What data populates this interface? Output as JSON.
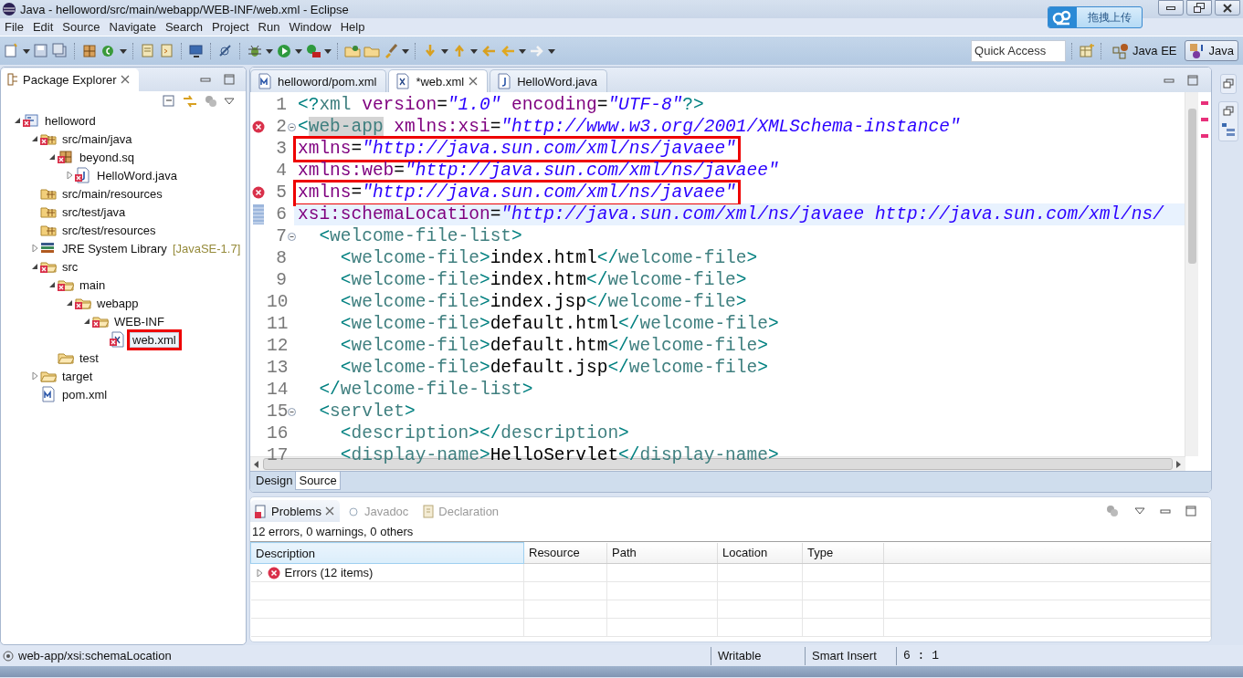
{
  "window": {
    "title": "Java - helloword/src/main/webapp/WEB-INF/web.xml - Eclipse",
    "upload_button": "拖拽上传"
  },
  "menu": [
    "File",
    "Edit",
    "Source",
    "Navigate",
    "Search",
    "Project",
    "Run",
    "Window",
    "Help"
  ],
  "quick_access": {
    "placeholder": "Quick Access"
  },
  "perspectives": [
    {
      "label": "Java EE",
      "selected": false
    },
    {
      "label": "Java",
      "selected": true
    }
  ],
  "package_explorer": {
    "title": "Package Explorer",
    "tree": [
      {
        "label": "helloword",
        "kind": "project",
        "error": true,
        "expanded": true,
        "children": [
          {
            "label": "src/main/java",
            "kind": "source-folder",
            "error": true,
            "expanded": true,
            "children": [
              {
                "label": "beyond.sq",
                "kind": "package",
                "error": true,
                "expanded": true,
                "children": [
                  {
                    "label": "HelloWord.java",
                    "kind": "java",
                    "error": true,
                    "expanded": false
                  }
                ]
              }
            ]
          },
          {
            "label": "src/main/resources",
            "kind": "source-folder",
            "error": false
          },
          {
            "label": "src/test/java",
            "kind": "source-folder",
            "error": false
          },
          {
            "label": "src/test/resources",
            "kind": "source-folder",
            "error": false
          },
          {
            "label": "JRE System Library",
            "decoration": "[JavaSE-1.7]",
            "kind": "library",
            "error": false,
            "expanded": false
          },
          {
            "label": "src",
            "kind": "folder",
            "error": true,
            "expanded": true,
            "children": [
              {
                "label": "main",
                "kind": "folder",
                "error": true,
                "expanded": true,
                "children": [
                  {
                    "label": "webapp",
                    "kind": "folder",
                    "error": true,
                    "expanded": true,
                    "children": [
                      {
                        "label": "WEB-INF",
                        "kind": "folder",
                        "error": true,
                        "expanded": true,
                        "children": [
                          {
                            "label": "web.xml",
                            "kind": "xml",
                            "error": true,
                            "boxed": true
                          }
                        ]
                      }
                    ]
                  }
                ]
              },
              {
                "label": "test",
                "kind": "folder",
                "error": false
              }
            ]
          },
          {
            "label": "target",
            "kind": "folder",
            "error": false,
            "expanded": false
          },
          {
            "label": "pom.xml",
            "kind": "maven",
            "error": false
          }
        ]
      }
    ]
  },
  "editor": {
    "tabs": [
      {
        "label": "helloword/pom.xml",
        "kind": "maven",
        "selected": false
      },
      {
        "label": "*web.xml",
        "kind": "xml",
        "selected": true
      },
      {
        "label": "HelloWord.java",
        "kind": "java",
        "selected": false
      }
    ],
    "lines": [
      {
        "number": "1",
        "error": false,
        "changed": false,
        "boxed": false,
        "current": false,
        "segments": [
          {
            "kind": "bracket",
            "text": "<?"
          },
          {
            "kind": "tag",
            "text": "xml"
          },
          {
            "kind": "attr",
            "text": " version"
          },
          {
            "kind": "equals",
            "text": "="
          },
          {
            "kind": "value",
            "text": "\"1.0\""
          },
          {
            "kind": "attr",
            "text": " encoding"
          },
          {
            "kind": "equals",
            "text": "="
          },
          {
            "kind": "value",
            "text": "\"UTF-8\""
          },
          {
            "kind": "bracket",
            "text": "?>"
          }
        ]
      },
      {
        "number": "2",
        "error": true,
        "changed": false,
        "fold": true,
        "boxed": false,
        "current": false,
        "segments": [
          {
            "kind": "bracket",
            "text": "<"
          },
          {
            "kind": "tag-occurrence",
            "text": "web-app"
          },
          {
            "kind": "attr",
            "text": " xmlns:xsi"
          },
          {
            "kind": "equals",
            "text": "="
          },
          {
            "kind": "value",
            "text": "\"http://www.w3.org/2001/XMLSchema-instance\""
          }
        ]
      },
      {
        "number": "3",
        "error": false,
        "changed": false,
        "boxed": true,
        "current": false,
        "segments": [
          {
            "kind": "attr",
            "text": "xmlns"
          },
          {
            "kind": "equals",
            "text": "="
          },
          {
            "kind": "value",
            "text": "\"http://java.sun.com/xml/ns/javaee\""
          }
        ]
      },
      {
        "number": "4",
        "error": false,
        "changed": false,
        "boxed": false,
        "current": false,
        "segments": [
          {
            "kind": "attr",
            "text": "xmlns:web"
          },
          {
            "kind": "equals",
            "text": "="
          },
          {
            "kind": "value",
            "text": "\"http://java.sun.com/xml/ns/javaee\""
          }
        ]
      },
      {
        "number": "5",
        "error": true,
        "changed": false,
        "boxed": true,
        "current": false,
        "segments": [
          {
            "kind": "attr",
            "text": "xmlns"
          },
          {
            "kind": "equals",
            "text": "="
          },
          {
            "kind": "value",
            "text": "\"http://java.sun.com/xml/ns/javaee\""
          }
        ]
      },
      {
        "number": "6",
        "error": false,
        "changed": true,
        "boxed": false,
        "current": true,
        "segments": [
          {
            "kind": "attr",
            "text": "xsi:schemaLocation"
          },
          {
            "kind": "equals",
            "text": "="
          },
          {
            "kind": "value",
            "text": "\"http://java.sun.com/xml/ns/javaee http://java.sun.com/xml/ns/"
          }
        ]
      },
      {
        "number": "7",
        "error": false,
        "changed": false,
        "fold": true,
        "boxed": false,
        "current": false,
        "segments": [
          {
            "kind": "bracket",
            "text": "  <"
          },
          {
            "kind": "tag",
            "text": "welcome-file-list"
          },
          {
            "kind": "bracket",
            "text": ">"
          }
        ]
      },
      {
        "number": "8",
        "error": false,
        "changed": false,
        "boxed": false,
        "current": false,
        "segments": [
          {
            "kind": "bracket",
            "text": "    <"
          },
          {
            "kind": "tag",
            "text": "welcome-file"
          },
          {
            "kind": "bracket",
            "text": ">"
          },
          {
            "kind": "text",
            "text": "index.html"
          },
          {
            "kind": "bracket",
            "text": "</"
          },
          {
            "kind": "tag",
            "text": "welcome-file"
          },
          {
            "kind": "bracket",
            "text": ">"
          }
        ]
      },
      {
        "number": "9",
        "error": false,
        "changed": false,
        "boxed": false,
        "current": false,
        "segments": [
          {
            "kind": "bracket",
            "text": "    <"
          },
          {
            "kind": "tag",
            "text": "welcome-file"
          },
          {
            "kind": "bracket",
            "text": ">"
          },
          {
            "kind": "text",
            "text": "index.htm"
          },
          {
            "kind": "bracket",
            "text": "</"
          },
          {
            "kind": "tag",
            "text": "welcome-file"
          },
          {
            "kind": "bracket",
            "text": ">"
          }
        ]
      },
      {
        "number": "10",
        "error": false,
        "changed": false,
        "boxed": false,
        "current": false,
        "segments": [
          {
            "kind": "bracket",
            "text": "    <"
          },
          {
            "kind": "tag",
            "text": "welcome-file"
          },
          {
            "kind": "bracket",
            "text": ">"
          },
          {
            "kind": "text",
            "text": "index.jsp"
          },
          {
            "kind": "bracket",
            "text": "</"
          },
          {
            "kind": "tag",
            "text": "welcome-file"
          },
          {
            "kind": "bracket",
            "text": ">"
          }
        ]
      },
      {
        "number": "11",
        "error": false,
        "changed": false,
        "boxed": false,
        "current": false,
        "segments": [
          {
            "kind": "bracket",
            "text": "    <"
          },
          {
            "kind": "tag",
            "text": "welcome-file"
          },
          {
            "kind": "bracket",
            "text": ">"
          },
          {
            "kind": "text",
            "text": "default.html"
          },
          {
            "kind": "bracket",
            "text": "</"
          },
          {
            "kind": "tag",
            "text": "welcome-file"
          },
          {
            "kind": "bracket",
            "text": ">"
          }
        ]
      },
      {
        "number": "12",
        "error": false,
        "changed": false,
        "boxed": false,
        "current": false,
        "segments": [
          {
            "kind": "bracket",
            "text": "    <"
          },
          {
            "kind": "tag",
            "text": "welcome-file"
          },
          {
            "kind": "bracket",
            "text": ">"
          },
          {
            "kind": "text",
            "text": "default.htm"
          },
          {
            "kind": "bracket",
            "text": "</"
          },
          {
            "kind": "tag",
            "text": "welcome-file"
          },
          {
            "kind": "bracket",
            "text": ">"
          }
        ]
      },
      {
        "number": "13",
        "error": false,
        "changed": false,
        "boxed": false,
        "current": false,
        "segments": [
          {
            "kind": "bracket",
            "text": "    <"
          },
          {
            "kind": "tag",
            "text": "welcome-file"
          },
          {
            "kind": "bracket",
            "text": ">"
          },
          {
            "kind": "text",
            "text": "default.jsp"
          },
          {
            "kind": "bracket",
            "text": "</"
          },
          {
            "kind": "tag",
            "text": "welcome-file"
          },
          {
            "kind": "bracket",
            "text": ">"
          }
        ]
      },
      {
        "number": "14",
        "error": false,
        "changed": false,
        "boxed": false,
        "current": false,
        "segments": [
          {
            "kind": "bracket",
            "text": "  </"
          },
          {
            "kind": "tag",
            "text": "welcome-file-list"
          },
          {
            "kind": "bracket",
            "text": ">"
          }
        ]
      },
      {
        "number": "15",
        "error": false,
        "changed": false,
        "fold": true,
        "boxed": false,
        "current": false,
        "segments": [
          {
            "kind": "bracket",
            "text": "  <"
          },
          {
            "kind": "tag",
            "text": "servlet"
          },
          {
            "kind": "bracket",
            "text": ">"
          }
        ]
      },
      {
        "number": "16",
        "error": false,
        "changed": false,
        "boxed": false,
        "current": false,
        "segments": [
          {
            "kind": "bracket",
            "text": "    <"
          },
          {
            "kind": "tag",
            "text": "description"
          },
          {
            "kind": "bracket",
            "text": "></"
          },
          {
            "kind": "tag",
            "text": "description"
          },
          {
            "kind": "bracket",
            "text": ">"
          }
        ]
      },
      {
        "number": "17",
        "error": false,
        "changed": false,
        "boxed": false,
        "current": false,
        "segments": [
          {
            "kind": "bracket",
            "text": "    <"
          },
          {
            "kind": "tag",
            "text": "display-name"
          },
          {
            "kind": "bracket",
            "text": ">"
          },
          {
            "kind": "text",
            "text": "HelloServlet"
          },
          {
            "kind": "bracket",
            "text": "</"
          },
          {
            "kind": "tag",
            "text": "display-name"
          },
          {
            "kind": "bracket",
            "text": ">"
          }
        ]
      }
    ],
    "mode_tabs": [
      {
        "label": "Design",
        "selected": false
      },
      {
        "label": "Source",
        "selected": true
      }
    ]
  },
  "problems": {
    "tabs": [
      {
        "label": "Problems",
        "selected": true
      },
      {
        "label": "Javadoc",
        "selected": false
      },
      {
        "label": "Declaration",
        "selected": false
      }
    ],
    "summary": "12 errors, 0 warnings, 0 others",
    "columns": [
      "Description",
      "Resource",
      "Path",
      "Location",
      "Type"
    ],
    "rows": [
      {
        "label": "Errors (12 items)",
        "expanded": false
      }
    ]
  },
  "status_bar": {
    "path": "web-app/xsi:schemaLocation",
    "writable": "Writable",
    "insert_mode": "Smart Insert",
    "position": "6 : 1"
  }
}
